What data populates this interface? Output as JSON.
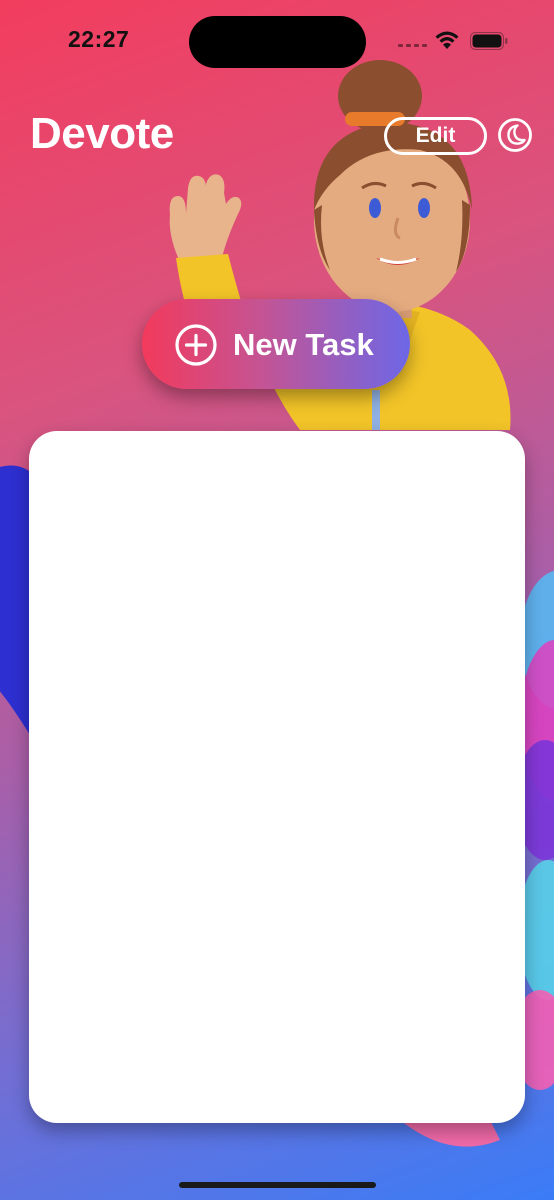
{
  "status_bar": {
    "time": "22:27",
    "icons": [
      "cellular-icon",
      "wifi-icon",
      "battery-icon"
    ]
  },
  "header": {
    "title": "Devote",
    "edit_label": "Edit",
    "theme_toggle_icon": "moon-icon"
  },
  "new_task_button": {
    "label": "New Task",
    "icon": "plus-circle-icon"
  },
  "task_list": {
    "items": []
  },
  "colors": {
    "gradient_top": "#f23d5e",
    "gradient_bottom": "#3a7cf7",
    "button_left": "#f23a5c",
    "button_right": "#6d67e6",
    "card": "#ffffff"
  }
}
